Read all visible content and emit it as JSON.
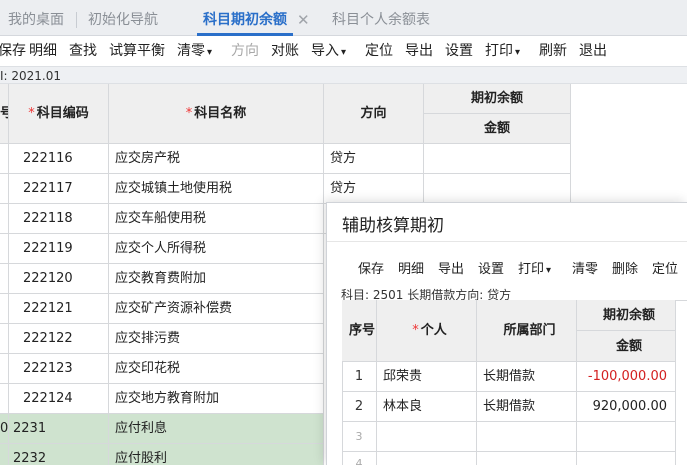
{
  "tabs": [
    {
      "label": "我的桌面"
    },
    {
      "label": "初始化导航"
    },
    {
      "label": "科目期初余额"
    },
    {
      "label": "科目个人余额表"
    }
  ],
  "tab_close": "✕",
  "toolbar": {
    "items": [
      "保存",
      "明细",
      "查找",
      "试算平衡",
      "清零",
      "方向",
      "对账",
      "导入",
      "定位",
      "导出",
      "设置",
      "打印",
      "刷新",
      "退出"
    ]
  },
  "period_text": "I: 2021.01",
  "table": {
    "headers": {
      "c0": "号",
      "code": "科目编码",
      "name": "科目名称",
      "direction": "方向",
      "opening": "期初余额",
      "amount": "金额"
    },
    "rows": [
      {
        "code": "222116",
        "name": "应交房产税",
        "dir": "贷方"
      },
      {
        "code": "222117",
        "name": "应交城镇土地使用税",
        "dir": "贷方"
      },
      {
        "code": "222118",
        "name": "应交车船使用税",
        "dir": ""
      },
      {
        "code": "222119",
        "name": "应交个人所得税",
        "dir": ""
      },
      {
        "code": "222120",
        "name": "应交教育费附加",
        "dir": ""
      },
      {
        "code": "222121",
        "name": "应交矿产资源补偿费",
        "dir": ""
      },
      {
        "code": "222122",
        "name": "应交排污费",
        "dir": ""
      },
      {
        "code": "222123",
        "name": "应交印花税",
        "dir": ""
      },
      {
        "code": "222124",
        "name": "应交地方教育附加",
        "dir": ""
      },
      {
        "c0": "0",
        "code": "2231",
        "name": "应付利息",
        "dir": ""
      },
      {
        "code": "2232",
        "name": "应付股利",
        "dir": ""
      }
    ]
  },
  "dialog": {
    "title": "辅助核算期初",
    "toolbar": [
      "保存",
      "明细",
      "导出",
      "设置",
      "打印",
      "清零",
      "删除",
      "定位"
    ],
    "subject_text": "科目: 2501 长期借款方向: 贷方",
    "headers": {
      "index": "序号",
      "person": "个人",
      "dept": "所属部门",
      "opening": "期初余额",
      "amount": "金额"
    },
    "rows": [
      {
        "index": "1",
        "person": "邱荣贵",
        "dept": "长期借款",
        "amount": "-100,000.00"
      },
      {
        "index": "2",
        "person": "林本良",
        "dept": "长期借款",
        "amount": "920,000.00"
      },
      {
        "index": "3",
        "person": "",
        "dept": "",
        "amount": ""
      },
      {
        "index": "4",
        "person": "",
        "dept": "",
        "amount": ""
      }
    ]
  }
}
